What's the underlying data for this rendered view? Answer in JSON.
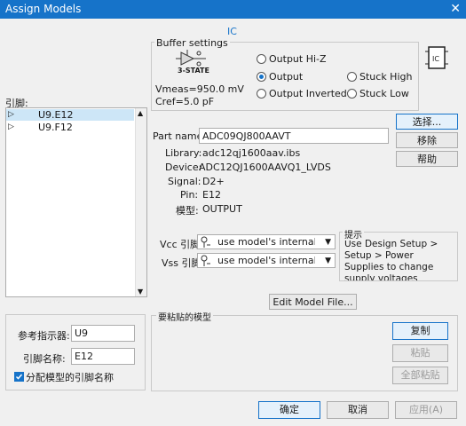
{
  "window": {
    "title": "Assign Models",
    "close_glyph": "✕"
  },
  "ic_label": "IC",
  "buffer_settings": {
    "title": "Buffer settings",
    "icon_caption": "3-STATE",
    "vmeas": "Vmeas=950.0 mV",
    "cref": "Cref=5.0 pF",
    "radios": [
      {
        "label": "Output Hi-Z",
        "checked": false
      },
      {
        "label": "Output",
        "checked": true
      },
      {
        "label": "Output Inverted",
        "checked": false
      },
      {
        "label": "Stuck High",
        "checked": false
      },
      {
        "label": "Stuck Low",
        "checked": false
      }
    ]
  },
  "pins": {
    "label": "引脚:",
    "items": [
      {
        "name": "U9.E12",
        "selected": true
      },
      {
        "name": "U9.F12",
        "selected": false
      }
    ]
  },
  "model": {
    "part_name_label": "Part name:",
    "part_name_value": "ADC09QJ800AAVT",
    "library_label": "Library:",
    "library_value": "adc12qj1600aav.ibs",
    "device_label": "Device:",
    "device_value": "ADC12QJ1600AAVQ1_LVDS",
    "signal_label": "Signal:",
    "signal_value": "D2+",
    "pin_label": "Pin:",
    "pin_value": "E12",
    "model_label": "模型:",
    "model_value": "OUTPUT"
  },
  "buttons": {
    "select": "选择...",
    "remove": "移除",
    "help": "帮助",
    "edit_model": "Edit Model File...",
    "copy": "复制",
    "paste": "粘贴",
    "paste_all": "全部粘贴",
    "ok": "确定",
    "cancel": "取消",
    "apply": "应用(A)"
  },
  "supply": {
    "vcc_label": "Vcc 引脚:",
    "vcc_value": "use model's internal va",
    "vss_label": "Vss 引脚:",
    "vss_value": "use model's internal va"
  },
  "hint": {
    "title": "提示",
    "text": "Use Design Setup > Setup > Power Supplies to change supply voltages"
  },
  "paste_group": {
    "title": "要粘贴的模型"
  },
  "refdes": {
    "ref_label": "参考指示器:",
    "ref_value": "U9",
    "pin_label": "引脚名称:",
    "pin_value": "E12",
    "check_label": "分配模型的引脚名称",
    "check_checked": true
  },
  "colors": {
    "accent": "#1673c9",
    "title_bar": "#1673c9"
  }
}
